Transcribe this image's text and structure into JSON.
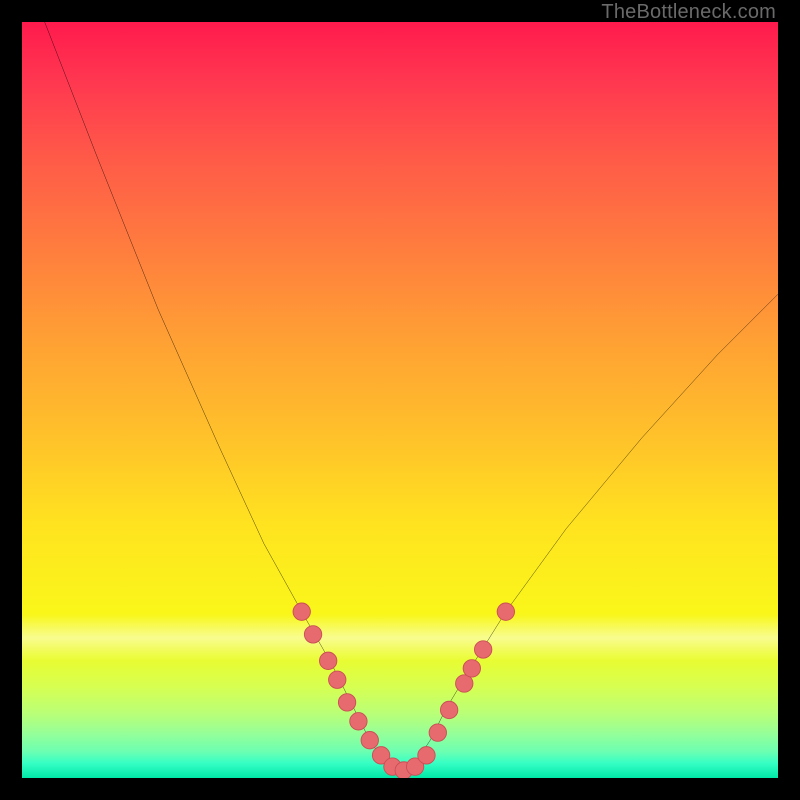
{
  "watermark": {
    "text": "TheBottleneck.com"
  },
  "colors": {
    "frame_bg": "#000000",
    "curve_stroke": "#000000",
    "dot_fill": "#e76a6f",
    "dot_stroke": "#c94f55",
    "gradient_stops": [
      "#ff1a4d",
      "#ff7d3e",
      "#ffe41f",
      "#97ff97",
      "#00e8a8"
    ]
  },
  "chart_data": {
    "type": "line",
    "title": "",
    "xlabel": "",
    "ylabel": "",
    "xlim": [
      0,
      100
    ],
    "ylim": [
      0,
      100
    ],
    "curve": {
      "name": "bottleneck-curve",
      "x": [
        3,
        10,
        18,
        26,
        32,
        37,
        41,
        44,
        46,
        48,
        50,
        52,
        54,
        56,
        59,
        64,
        72,
        82,
        92,
        100
      ],
      "y": [
        100,
        82,
        62,
        44,
        31,
        22,
        15,
        9,
        5,
        2,
        1,
        2,
        5,
        9,
        14,
        22,
        33,
        45,
        56,
        64
      ]
    },
    "markers": {
      "name": "highlighted-points",
      "x": [
        37.0,
        38.5,
        40.5,
        41.7,
        43.0,
        44.5,
        46.0,
        47.5,
        49.0,
        50.5,
        52.0,
        53.5,
        55.0,
        56.5,
        58.5,
        59.5,
        61.0,
        64.0
      ],
      "y": [
        22.0,
        19.0,
        15.5,
        13.0,
        10.0,
        7.5,
        5.0,
        3.0,
        1.5,
        1.0,
        1.5,
        3.0,
        6.0,
        9.0,
        12.5,
        14.5,
        17.0,
        22.0
      ]
    },
    "background_meaning": "vertical gradient encodes bottleneck severity (red=high, green=low)"
  }
}
